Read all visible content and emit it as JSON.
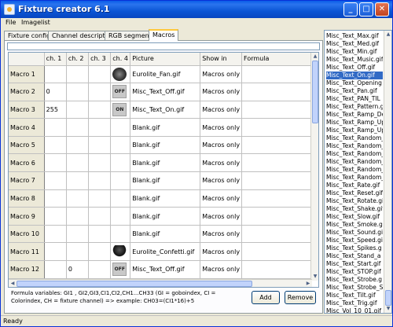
{
  "window": {
    "title": "Fixture creator 6.1",
    "minimize": "_",
    "maximize": "□",
    "close": "✕"
  },
  "menu": [
    {
      "label": "File"
    },
    {
      "label": "Imagelist"
    }
  ],
  "tabs": [
    {
      "label": "Fixture config."
    },
    {
      "label": "Channel description"
    },
    {
      "label": "RGB segments"
    },
    {
      "label": "Macros",
      "active": true
    }
  ],
  "grid": {
    "headers": [
      "",
      "ch. 1",
      "ch. 2",
      "ch. 3",
      "ch. 4",
      "Picture",
      "Show in",
      "Formula"
    ],
    "rows": [
      {
        "name": "Macro 1",
        "ch1": "",
        "ch2": "",
        "ch3": "",
        "icon": "fan",
        "picture": "Eurolite_Fan.gif",
        "show": "Macros only"
      },
      {
        "name": "Macro 2",
        "ch1": "0",
        "ch2": "",
        "ch3": "",
        "icon": "off",
        "icon_text": "OFF",
        "picture": "Misc_Text_Off.gif",
        "show": "Macros only"
      },
      {
        "name": "Macro 3",
        "ch1": "255",
        "ch2": "",
        "ch3": "",
        "icon": "on",
        "icon_text": "ON",
        "picture": "Misc_Text_On.gif",
        "show": "Macros only"
      },
      {
        "name": "Macro 4",
        "ch1": "",
        "ch2": "",
        "ch3": "",
        "icon": "blank",
        "picture": "Blank.gif",
        "show": "Macros only"
      },
      {
        "name": "Macro 5",
        "ch1": "",
        "ch2": "",
        "ch3": "",
        "icon": "blank",
        "picture": "Blank.gif",
        "show": "Macros only"
      },
      {
        "name": "Macro 6",
        "ch1": "",
        "ch2": "",
        "ch3": "",
        "icon": "blank",
        "picture": "Blank.gif",
        "show": "Macros only"
      },
      {
        "name": "Macro 7",
        "ch1": "",
        "ch2": "",
        "ch3": "",
        "icon": "blank",
        "picture": "Blank.gif",
        "show": "Macros only"
      },
      {
        "name": "Macro 8",
        "ch1": "",
        "ch2": "",
        "ch3": "",
        "icon": "blank",
        "picture": "Blank.gif",
        "show": "Macros only"
      },
      {
        "name": "Macro 9",
        "ch1": "",
        "ch2": "",
        "ch3": "",
        "icon": "blank",
        "picture": "Blank.gif",
        "show": "Macros only"
      },
      {
        "name": "Macro 10",
        "ch1": "",
        "ch2": "",
        "ch3": "",
        "icon": "blank",
        "picture": "Blank.gif",
        "show": "Macros only"
      },
      {
        "name": "Macro 11",
        "ch1": "",
        "ch2": "",
        "ch3": "",
        "icon": "confetti",
        "picture": "Eurolite_Confetti.gif",
        "show": "Macros only"
      },
      {
        "name": "Macro 12",
        "ch1": "",
        "ch2": "0",
        "ch3": "",
        "icon": "off",
        "icon_text": "OFF",
        "picture": "Misc_Text_Off.gif",
        "show": "Macros only"
      }
    ]
  },
  "formula_note": "Formula variables: GI1 , GI2,GI3,CI1,CI2,CH1...CH33 (GI = goboindex, CI = Colorindex, CH = fixture channel)  => example: CH03=(CI1*16)+5",
  "buttons": {
    "add": "Add",
    "remove": "Remove"
  },
  "imagelist": {
    "items": [
      "Misc_Text_Max.gif",
      "Misc_Text_Med.gif",
      "Misc_Text_Min.gif",
      "Misc_Text_Music.gif",
      "Misc_Text_Off.gif",
      "Misc_Text_On.gif",
      "Misc_Text_Opening",
      "Misc_Text_Pan.gif",
      "Misc_Text_PAN_TIL",
      "Misc_Text_Pattern.g",
      "Misc_Text_Ramp_De",
      "Misc_Text_Ramp_Up",
      "Misc_Text_Ramp_Up",
      "Misc_Text_Random_",
      "Misc_Text_Random_",
      "Misc_Text_Random_",
      "Misc_Text_Random_",
      "Misc_Text_Random_",
      "Misc_Text_Random_",
      "Misc_Text_Rate.gif",
      "Misc_Text_Reset.gif",
      "Misc_Text_Rotate.gi",
      "Misc_Text_Shake.gif",
      "Misc_Text_Slow.gif",
      "Misc_Text_Smoke.g",
      "Misc_Text_Sound.gi",
      "Misc_Text_Speed.gi",
      "Misc_Text_Spikes.g",
      "Misc_Text_Stand_a",
      "Misc_Text_Start.gif",
      "Misc_Text_STOP.gif",
      "Misc_Text_Strobe.g",
      "Misc_Text_Strobe_S",
      "Misc_Text_Tilt.gif",
      "Misc_Text_Trig.gif",
      "Misc_Vol_10_01.gif"
    ],
    "selected_index": 5
  },
  "status": {
    "text": "Ready"
  },
  "colors": {
    "title_blue": "#0a5ce8",
    "selection_blue": "#316ac5",
    "active_tab_accent": "#ffc83c"
  }
}
